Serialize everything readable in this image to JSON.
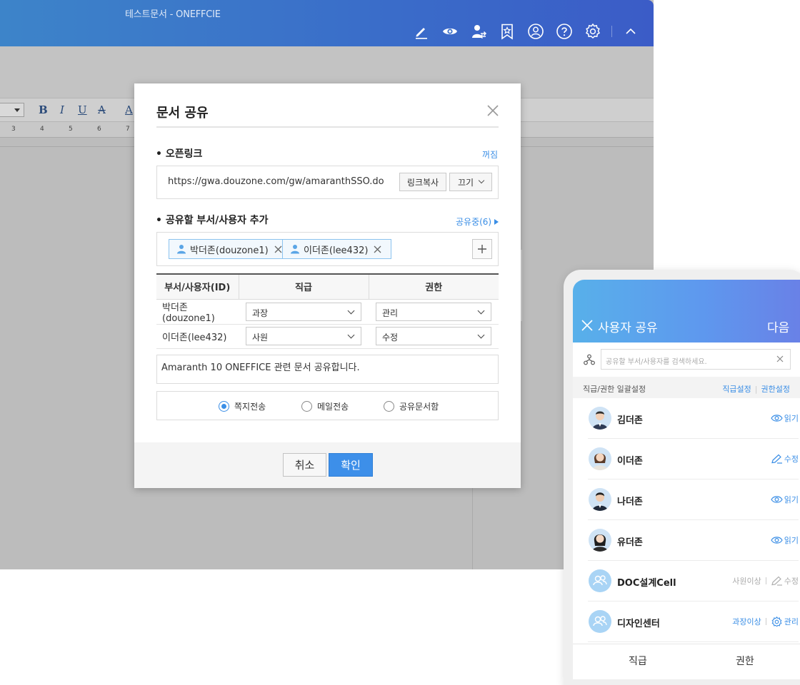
{
  "app": {
    "title": "테스트문서 - ONEFFCIE",
    "toolbar_icons": [
      "edit-icon",
      "eye-icon",
      "user-share-icon",
      "bookmark-icon",
      "account-icon",
      "help-icon",
      "settings-icon",
      "collapse-icon"
    ],
    "format_buttons": [
      "B",
      "I",
      "U",
      "A",
      "A"
    ],
    "ruler_numbers": [
      "3",
      "4",
      "5",
      "6",
      "7"
    ]
  },
  "dialog": {
    "title": "문서 공유",
    "open_link": {
      "heading": "• 오픈링크",
      "toggle_label": "꺼짐",
      "url": "https://gwa.douzone.com/gw/amaranthSSO.do",
      "copy_button": "링크복사",
      "off_select": "끄기"
    },
    "share_add": {
      "heading": "• 공유할 부서/사용자 추가",
      "sharing_link": "공유중(6)",
      "chips": [
        "박더존(douzone1)",
        "이더존(lee432)"
      ]
    },
    "table": {
      "headers": [
        "부서/사용자(ID)",
        "직급",
        "권한"
      ],
      "rows": [
        {
          "user": "박더존(douzone1)",
          "rank": "과장",
          "perm": "관리"
        },
        {
          "user": "이더존(lee432)",
          "rank": "사원",
          "perm": "수정"
        }
      ]
    },
    "message": "Amaranth 10 ONEFFICE 관련 문서 공유합니다.",
    "send_options": [
      {
        "label": "쪽지전송",
        "selected": true
      },
      {
        "label": "메일전송",
        "selected": false
      },
      {
        "label": "공유문서함",
        "selected": false
      }
    ],
    "cancel_button": "취소",
    "ok_button": "확인"
  },
  "mobile": {
    "title": "사용자 공유",
    "next": "다음",
    "search_placeholder": "공유할 부서/사용자를 검색하세요.",
    "bulk_label": "직급/권한 일괄설정",
    "bulk_rank_link": "직급설정",
    "bulk_perm_link": "권한설정",
    "users": [
      {
        "name": "김더존",
        "perm": "읽기",
        "perm_icon": "eye-icon",
        "level": "",
        "avatar": "person-male"
      },
      {
        "name": "이더존",
        "perm": "수정",
        "perm_icon": "pencil-icon",
        "level": "",
        "avatar": "person-female"
      },
      {
        "name": "나더존",
        "perm": "읽기",
        "perm_icon": "eye-icon",
        "level": "",
        "avatar": "person-male"
      },
      {
        "name": "유더존",
        "perm": "읽기",
        "perm_icon": "eye-icon",
        "level": "",
        "avatar": "person-female"
      },
      {
        "name": "DOC설계Cell",
        "perm": "수정",
        "perm_icon": "pencil-icon",
        "level": "사원이상",
        "avatar": "group"
      },
      {
        "name": "디자인센터",
        "perm": "관리",
        "perm_icon": "gear-icon",
        "level": "과장이상",
        "avatar": "group"
      }
    ],
    "tab_rank": "직급",
    "tab_perm": "권한"
  },
  "colors": {
    "accent": "#3a8ee6",
    "titlebar": "#3b6fc9",
    "ok_button": "#3d8fe9"
  }
}
